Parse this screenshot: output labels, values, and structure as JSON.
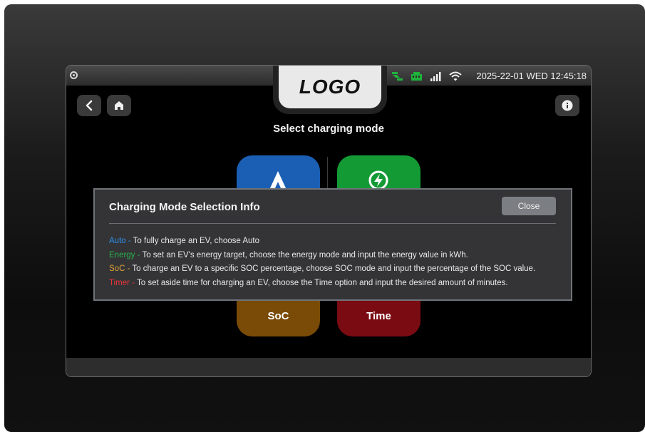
{
  "logo": {
    "text": "LOGO"
  },
  "status": {
    "datetime": "2025-22-01 WED 12:45:18",
    "colors": {
      "ok_green": "#20b33c"
    }
  },
  "header": {
    "back_icon": "chevron-left-icon",
    "home_icon": "home-icon",
    "info_icon": "info-icon"
  },
  "main": {
    "title": "Select charging mode",
    "modes": [
      {
        "label": "",
        "color": "#1a5fb4",
        "icon": "auto-a-icon"
      },
      {
        "label": "",
        "color": "#139a35",
        "icon": "lightning-circle-icon"
      },
      {
        "label": "SoC",
        "color": "#7a4a07"
      },
      {
        "label": "Time",
        "color": "#7a0b12"
      }
    ]
  },
  "modal": {
    "title": "Charging Mode Selection Info",
    "close_label": "Close",
    "lines": [
      {
        "key": "Auto -",
        "key_color": "#2f8fe8",
        "text": " To fully charge an EV, choose Auto"
      },
      {
        "key": "Energy -",
        "key_color": "#27b24a",
        "text": " To set an EV's energy target, choose the energy mode and input the energy value in kWh."
      },
      {
        "key": "SoC -",
        "key_color": "#e0a33a",
        "text": " To charge an EV to a specific SOC percentage, choose SOC mode and input the percentage of the SOC value."
      },
      {
        "key": "Timer -",
        "key_color": "#e8343a",
        "text": " To set aside time for charging an EV, choose the Time option and input the desired amount of minutes."
      }
    ]
  }
}
